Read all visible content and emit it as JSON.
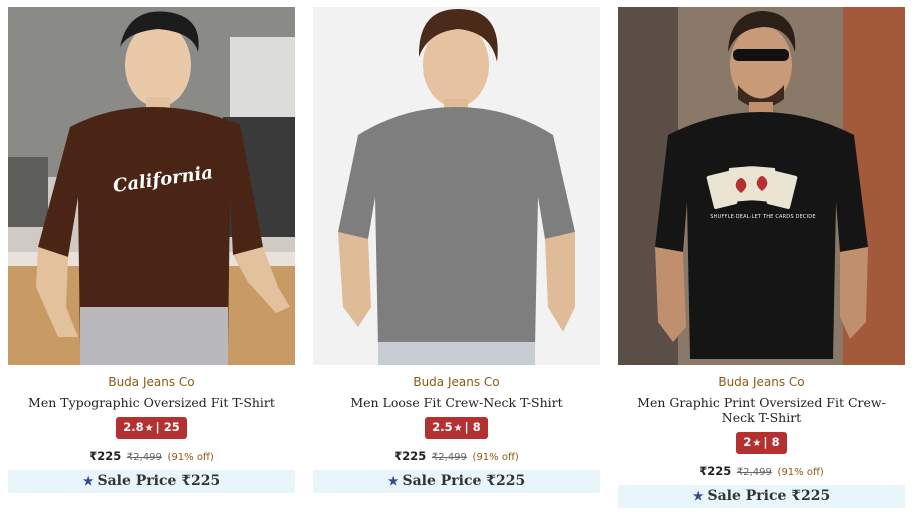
{
  "products": [
    {
      "brand": "Buda Jeans Co",
      "title": "Men Typographic Oversized Fit T-Shirt",
      "rating": "2.8",
      "reviews": "25",
      "price": "₹225",
      "mrp": "₹2,499",
      "discount": "(91% off)",
      "sale_label": "Sale Price ₹225",
      "shirt_print": "California",
      "shirt_color": "#4a2414"
    },
    {
      "brand": "Buda Jeans Co",
      "title": "Men Loose Fit Crew-Neck T-Shirt",
      "rating": "2.5",
      "reviews": "8",
      "price": "₹225",
      "mrp": "₹2,499",
      "discount": "(91% off)",
      "sale_label": "Sale Price ₹225",
      "shirt_color": "#7e7e7e"
    },
    {
      "brand": "Buda Jeans Co",
      "title": "Men Graphic Print Oversized Fit Crew-Neck T-Shirt",
      "rating": "2",
      "reviews": "8",
      "price": "₹225",
      "mrp": "₹2,499",
      "discount": "(91% off)",
      "sale_label": "Sale Price ₹225",
      "shirt_print": "SHUFFLE·DEAL·LET THE CARDS DECIDE",
      "shirt_color": "#151515"
    }
  ],
  "colors": {
    "brand_text": "#8b5a12",
    "rating_badge": "#b33131",
    "sale_bg": "#e8f6fc",
    "sale_star": "#3a4a8c"
  },
  "icons": {
    "rating": "star-icon",
    "sale": "star-icon"
  }
}
